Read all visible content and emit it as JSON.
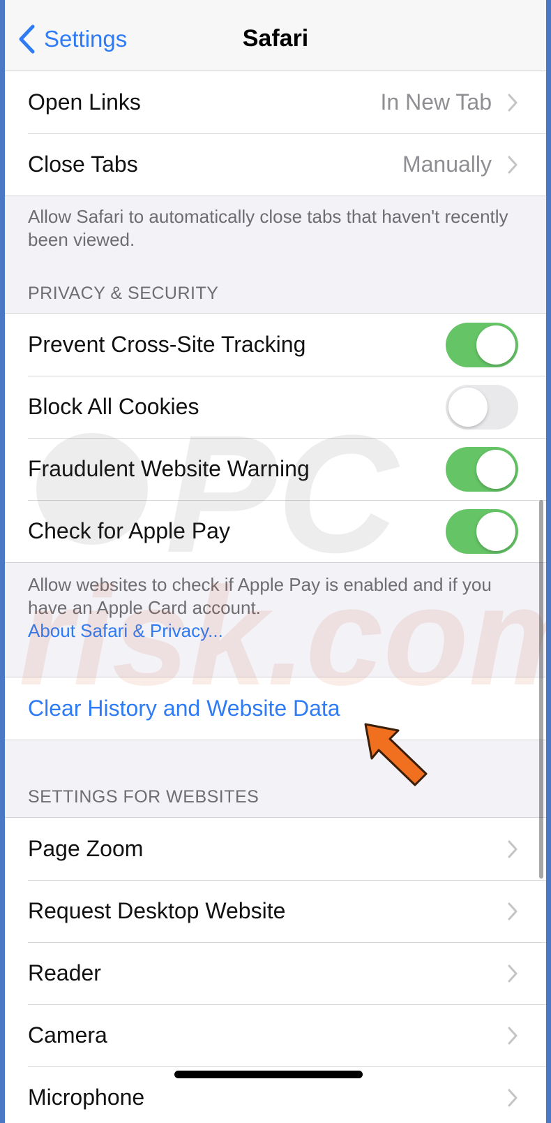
{
  "nav": {
    "back_label": "Settings",
    "title": "Safari"
  },
  "tabs_group": {
    "items": [
      {
        "label": "Open Links",
        "value": "In New Tab"
      },
      {
        "label": "Close Tabs",
        "value": "Manually"
      }
    ],
    "footer": "Allow Safari to automatically close tabs that haven't recently been viewed."
  },
  "privacy": {
    "header": "PRIVACY & SECURITY",
    "items": [
      {
        "label": "Prevent Cross-Site Tracking",
        "on": true
      },
      {
        "label": "Block All Cookies",
        "on": false
      },
      {
        "label": "Fraudulent Website Warning",
        "on": true
      },
      {
        "label": "Check for Apple Pay",
        "on": true
      }
    ],
    "footer": "Allow websites to check if Apple Pay is enabled and if you have an Apple Card account.",
    "footer_link": "About Safari & Privacy..."
  },
  "clear_action": {
    "label": "Clear History and Website Data"
  },
  "websites": {
    "header": "SETTINGS FOR WEBSITES",
    "items": [
      {
        "label": "Page Zoom"
      },
      {
        "label": "Request Desktop Website"
      },
      {
        "label": "Reader"
      },
      {
        "label": "Camera"
      },
      {
        "label": "Microphone"
      }
    ]
  },
  "watermark": {
    "text": "PCrisk.com"
  },
  "colors": {
    "accent": "#2f7bf6",
    "toggle_on": "#65c466",
    "arrow": "#f07020"
  }
}
